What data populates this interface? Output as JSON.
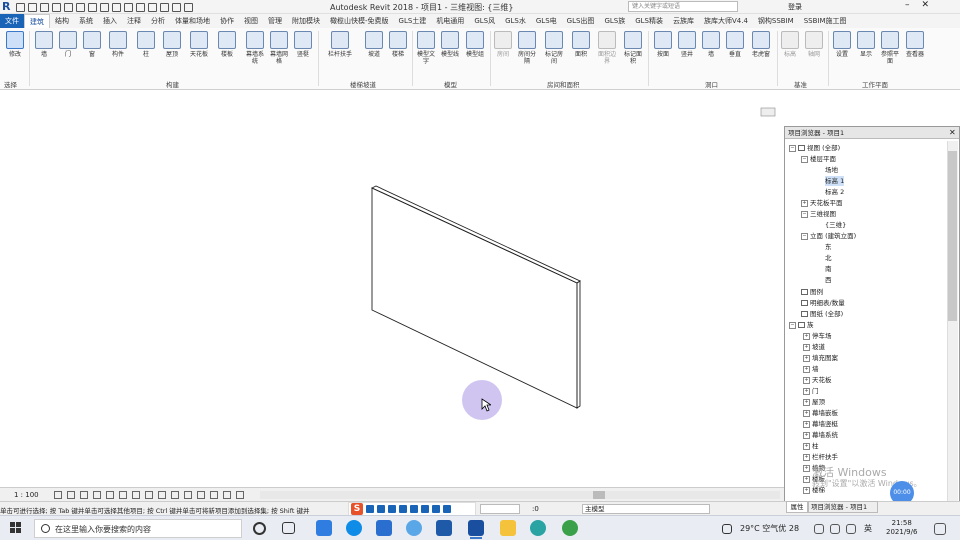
{
  "window": {
    "title": "Autodesk Revit 2018 -   项目1 - 三维视图: {三维}",
    "search_placeholder": "键入关键字或短语",
    "login": "登录"
  },
  "tabs": [
    "文件",
    "建筑",
    "结构",
    "系统",
    "插入",
    "注释",
    "分析",
    "体量和场地",
    "协作",
    "视图",
    "管理",
    "附加模块",
    "橄榄山快模-免费版",
    "GLS土建",
    "机电通用",
    "GLS风",
    "GLS水",
    "GLS电",
    "GLS出图",
    "GLS族",
    "GLS精装",
    "云族库",
    "族库大师V4.4",
    "钢构SSBIM",
    "SSBIM施工图"
  ],
  "ribbon": {
    "buttons": [
      "修改",
      "墙",
      "门",
      "窗",
      "构件",
      "柱",
      "屋顶",
      "天花板",
      "楼板",
      "幕墙系统",
      "幕墙网格",
      "竖梃",
      "栏杆扶手",
      "坡道",
      "楼梯",
      "模型文字",
      "模型线",
      "模型组",
      "房间",
      "房间分隔",
      "标记房间",
      "面积",
      "面积边界",
      "标记面积",
      "按面",
      "竖井",
      "墙",
      "垂直",
      "老虎窗",
      "标高",
      "轴网",
      "设置",
      "显示",
      "参照平面",
      "查看器"
    ],
    "panels": [
      "选择",
      "构建",
      "楼梯坡道",
      "模型",
      "房间和面积",
      "洞口",
      "基准",
      "工作平面"
    ]
  },
  "project_browser": {
    "title": "项目浏览器 - 项目1",
    "items": [
      "视图 (全部)",
      "楼层平面",
      "场地",
      "标高 1",
      "标高 2",
      "天花板平面",
      "三维视图",
      "{三维}",
      "立面 (建筑立面)",
      "东",
      "北",
      "南",
      "西",
      "图例",
      "明细表/数量",
      "图纸 (全部)",
      "族",
      "停车场",
      "坡道",
      "填充图案",
      "墙",
      "天花板",
      "门",
      "屋顶",
      "幕墙嵌板",
      "幕墙竖梃",
      "幕墙系统",
      "柱",
      "栏杆扶手",
      "植物",
      "楼板",
      "楼梯"
    ],
    "tabs": [
      "属性",
      "项目浏览器 - 项目1"
    ]
  },
  "view_control": {
    "scale": "1 : 100"
  },
  "status_bar": {
    "text": "单击可进行选择; 按 Tab 键并单击可选择其他项目; 按 Ctrl 键并单击可将新项目添加到选择集; 按 Shift 键并",
    "worksets_count": ":0",
    "model": "主模型"
  },
  "watermark": {
    "line1": "激活 Windows",
    "line2": "转到\"设置\"以激活 Windows。"
  },
  "timer": "00:00",
  "taskbar": {
    "search_placeholder": "在这里输入你要搜索的内容",
    "weather": "29°C  空气优 28",
    "ime": "英",
    "time": "21:58",
    "date": "2021/9/6"
  }
}
